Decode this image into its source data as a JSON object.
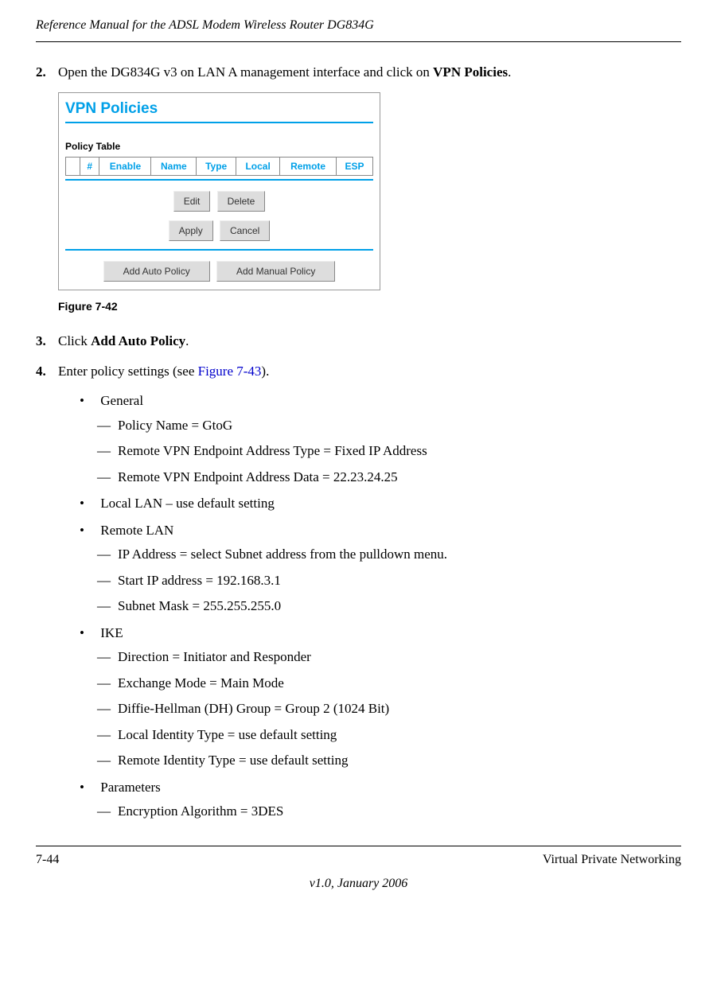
{
  "header": {
    "title": "Reference Manual for the ADSL Modem Wireless Router DG834G"
  },
  "steps": {
    "s2": {
      "num": "2.",
      "prefix": "Open the DG834G v3 on LAN A management interface and click on ",
      "bold": "VPN Policies",
      "suffix": "."
    },
    "s3": {
      "num": "3.",
      "prefix": "Click ",
      "bold": "Add Auto Policy",
      "suffix": "."
    },
    "s4": {
      "num": "4.",
      "prefix": "Enter policy settings (see ",
      "link": "Figure 7-43",
      "suffix": ")."
    }
  },
  "vpn": {
    "title": "VPN Policies",
    "policy_table_label": "Policy Table",
    "headers": {
      "h0": "",
      "h1": "#",
      "h2": "Enable",
      "h3": "Name",
      "h4": "Type",
      "h5": "Local",
      "h6": "Remote",
      "h7": "ESP"
    },
    "buttons": {
      "edit": "Edit",
      "delete": "Delete",
      "apply": "Apply",
      "cancel": "Cancel",
      "add_auto": "Add Auto Policy",
      "add_manual": "Add Manual Policy"
    }
  },
  "figure_caption": "Figure 7-42",
  "bullets": {
    "general": {
      "label": "General",
      "items": {
        "i1": "Policy Name = GtoG",
        "i2": "Remote VPN Endpoint Address Type = Fixed IP Address",
        "i3": "Remote VPN Endpoint Address Data = 22.23.24.25"
      }
    },
    "local_lan": {
      "label": "Local LAN – use default setting"
    },
    "remote_lan": {
      "label": "Remote LAN",
      "items": {
        "i1": "IP Address = select Subnet address from the pulldown menu.",
        "i2": "Start IP address = 192.168.3.1",
        "i3": "Subnet Mask = 255.255.255.0"
      }
    },
    "ike": {
      "label": "IKE",
      "items": {
        "i1": "Direction = Initiator and Responder",
        "i2": "Exchange Mode = Main Mode",
        "i3": "Diffie-Hellman (DH) Group = Group 2 (1024 Bit)",
        "i4": "Local Identity Type = use default setting",
        "i5": "Remote Identity Type = use default setting"
      }
    },
    "parameters": {
      "label": "Parameters",
      "items": {
        "i1": "Encryption Algorithm = 3DES"
      }
    }
  },
  "footer": {
    "page": "7-44",
    "section": "Virtual Private Networking",
    "version": "v1.0, January 2006"
  }
}
